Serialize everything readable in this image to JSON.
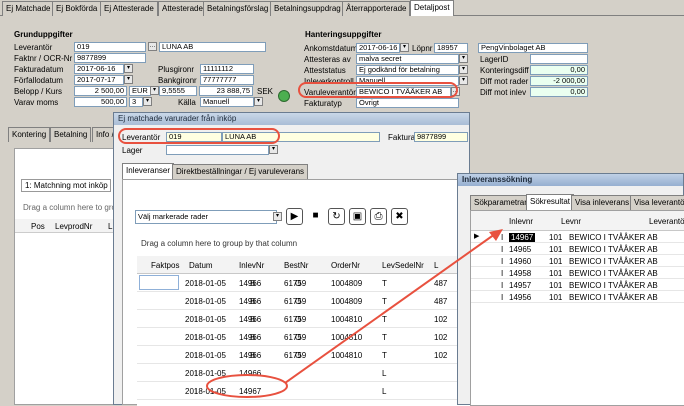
{
  "tabs": [
    "Ej Matchade",
    "Ej Bokförda",
    "Ej Attesterade",
    "Attesterade",
    "Betalningsförslag",
    "Betalningsuppdrag",
    "Återrapporterade",
    "Detaljpost"
  ],
  "grund": {
    "title": "Grunduppgifter",
    "leverantor_label": "Leverantör",
    "leverantor_nr": "019",
    "leverantor_namn": "LUNA AB",
    "faktnr_label": "Faktnr / OCR-Nr",
    "faktnr": "9877899",
    "fakturadatum_label": "Fakturadatum",
    "fakturadatum": "2017-06-16",
    "forfallo_label": "Förfallodatum",
    "forfallo": "2017-07-17",
    "belopp_label": "Belopp / Kurs",
    "belopp": "2 500,00",
    "valuta": "EUR",
    "kurs": "9,5555",
    "sek_belopp": "23 888,75",
    "sek": "SEK",
    "moms_label": "Varav moms",
    "moms": "500,00",
    "moms_kod": "3",
    "plusgiro_label": "Plusgironr",
    "plusgiro": "11111112",
    "bankgiro_label": "Bankgironr",
    "bankgiro": "77777777",
    "kalla_label": "Källa",
    "kalla": "Manuell"
  },
  "hant": {
    "title": "Hanteringsuppgifter",
    "ankomst_label": "Ankomstdatum",
    "ankomst": "2017-06-16",
    "lopnr_label": "Löpnr",
    "lopnr": "18957",
    "attest_av_label": "Attesteras av",
    "attest_av": "malva secret",
    "status_label": "Atteststatus",
    "status": "Ej godkänd för betalning",
    "inlev_label": "Inleverkontroll",
    "inlev": "Manuell",
    "varulev_label": "Varuleverantör",
    "varulev": "BEWICO I TVÅÅKER AB",
    "fakttyp_label": "Fakturatyp",
    "fakttyp": "Övrigt",
    "peng": "PengVinbolaget AB",
    "lagerid_label": "LagerID",
    "kontdiff_label": "Konteringsdiff",
    "kontdiff": "0,00",
    "diffrader_label": "Diff mot rader",
    "diffrader": "-2 000,00",
    "diffinlev_label": "Diff mot inlev",
    "diffinlev": "0,00"
  },
  "left_tabs": [
    "Kontering",
    "Betalning",
    "Info /"
  ],
  "left_list": {
    "item": "1: Matchning mot inköp",
    "drag": "Drag a column here to gro",
    "cols": [
      "Pos",
      "LevprodNr",
      "L"
    ]
  },
  "win1": {
    "title": "Ej matchade varurader från inköp",
    "lev_label": "Leverantör",
    "lev_nr": "019",
    "lev_namn": "LUNA AB",
    "faktura_label": "Faktura",
    "faktura": "9877899",
    "lager_label": "Lager",
    "tabs": [
      "Inleveranser",
      "Direktbeställningar / Ej varuleverans"
    ],
    "select": "Välj markerade rader",
    "drag": "Drag a column here to group by that column",
    "cols": [
      "Faktpos",
      "Datum",
      "InlevNr",
      "BestNr",
      "OrderNr",
      "LevSedelNr",
      "L"
    ],
    "rows": [
      [
        "",
        "2018-01-05",
        "I",
        "14966",
        "B",
        "61759",
        "O",
        "1004809",
        "",
        "T",
        "487"
      ],
      [
        "",
        "2018-01-05",
        "I",
        "14966",
        "B",
        "61759",
        "O",
        "1004809",
        "",
        "T",
        "487"
      ],
      [
        "",
        "2018-01-05",
        "I",
        "14966",
        "B",
        "61759",
        "O",
        "1004810",
        "",
        "T",
        "102"
      ],
      [
        "",
        "2018-01-05",
        "I",
        "14966",
        "B",
        "61759",
        "O",
        "1004810",
        "",
        "T",
        "102"
      ],
      [
        "",
        "2018-01-05",
        "I",
        "14966",
        "B",
        "61759",
        "O",
        "1004810",
        "",
        "T",
        "102"
      ],
      [
        "",
        "2018-01-05",
        "I",
        "14966",
        "",
        "",
        "",
        "",
        "",
        "L",
        ""
      ],
      [
        "",
        "2018-01-05",
        "I",
        "14967",
        "",
        "",
        "",
        "",
        "",
        "L",
        ""
      ],
      [
        "",
        "2018-01-05",
        "I",
        "14967",
        "",
        "",
        "",
        "",
        "",
        "",
        ""
      ]
    ]
  },
  "win2": {
    "title": "Inleveranssökning",
    "tabs": [
      "Sökparametrar",
      "Sökresultat",
      "Visa inleverans",
      "Visa leverantör"
    ],
    "cols": [
      "Inlevnr",
      "Levnr",
      "Leverantör"
    ],
    "rows": [
      [
        "I",
        "14967",
        "101",
        "BEWICO I TVÅÅKER AB"
      ],
      [
        "I",
        "14965",
        "101",
        "BEWICO I TVÅÅKER AB"
      ],
      [
        "I",
        "14960",
        "101",
        "BEWICO I TVÅÅKER AB"
      ],
      [
        "I",
        "14958",
        "101",
        "BEWICO I TVÅÅKER AB"
      ],
      [
        "I",
        "14957",
        "101",
        "BEWICO I TVÅÅKER AB"
      ],
      [
        "I",
        "14956",
        "101",
        "BEWICO I TVÅÅKER AB"
      ]
    ]
  }
}
